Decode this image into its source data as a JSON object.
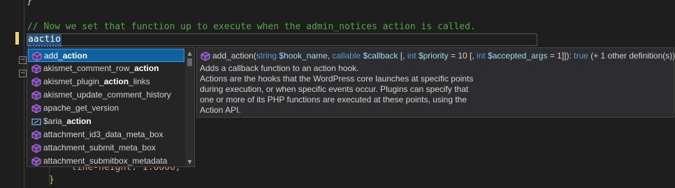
{
  "editor": {
    "top_brace": "}",
    "comment_line": "// Now we set that function up to execute when the admin_notices action is called.",
    "typed_text": "aactio",
    "css_line": "line-height: 1.6666;",
    "closing_brace": "}"
  },
  "completion": {
    "items": [
      {
        "label": "add_action",
        "icon": "method-cube-icon",
        "selected": true
      },
      {
        "label": "akismet_comment_row_action",
        "icon": "method-cube-icon"
      },
      {
        "label": "akismet_plugin_action_links",
        "icon": "method-cube-icon"
      },
      {
        "label": "akismet_update_comment_history",
        "icon": "method-cube-icon"
      },
      {
        "label": "apache_get_version",
        "icon": "method-cube-icon"
      },
      {
        "label": "$aria_action",
        "icon": "variable-icon"
      },
      {
        "label": "attachment_id3_data_meta_box",
        "icon": "method-cube-icon"
      },
      {
        "label": "attachment_submit_meta_box",
        "icon": "method-cube-icon"
      },
      {
        "label": "attachment_submitbox_metadata",
        "icon": "method-cube-icon"
      }
    ]
  },
  "tooltip": {
    "fn_name": "add_action(",
    "t_string": "string",
    "p_hook": "$hook_name",
    "sep1": ",",
    "t_callable": "callable",
    "p_callback": "$callback",
    "opt1": "[,",
    "t_int1": "int",
    "p_priority": "$priority",
    "def_priority": "= 10 [,",
    "t_int2": "int",
    "p_accepted": "$accepted_args",
    "def_accepted": "= 1]]):",
    "ret_type": "true",
    "overloads": "(+ 1 other definition(s))",
    "desc_lines": [
      "Adds a callback function to an action hook.",
      "Actions are the hooks that the WordPress core launches at specific points",
      "during execution, or when specific events occur. Plugins can specify that",
      "one or more of its PHP functions are executed at these points, using the",
      "Action API."
    ]
  },
  "colors": {
    "background": "#1e1e1e",
    "comment": "#57a64a",
    "selection": "#0e639c",
    "keyword": "#569cd6",
    "parameter": "#9cdcfe",
    "method_icon": "#b180d7"
  }
}
